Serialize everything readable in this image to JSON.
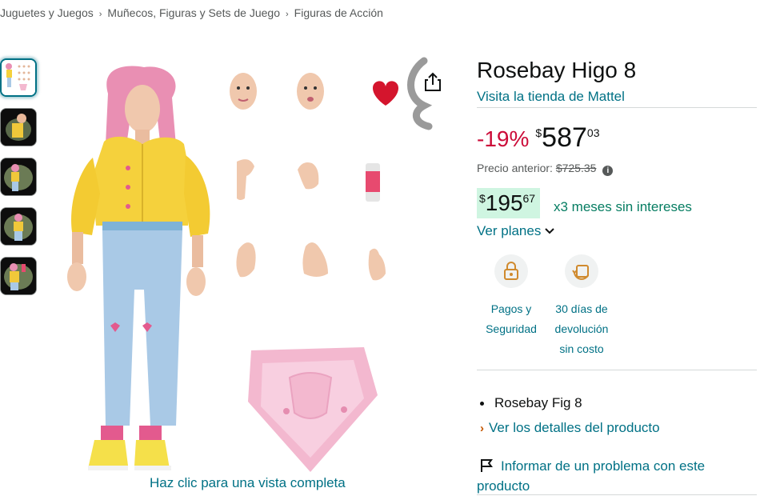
{
  "breadcrumb": [
    "Juguetes y Juegos",
    "Muñecos, Figuras y Sets de Juego",
    "Figuras de Acción"
  ],
  "breadcrumb_sep": "›",
  "gallery": {
    "view_full_label": "Haz clic para una vista completa"
  },
  "product": {
    "title": "Rosebay Higo 8",
    "store_link": "Visita la tienda de Mattel",
    "discount": "-19%",
    "currency": "$",
    "price_whole": "587",
    "price_fraction": "03",
    "previous_price_label": "Precio anterior:",
    "previous_price": "$725.35",
    "info_icon": "i",
    "installment_whole": "195",
    "installment_fraction": "67",
    "installment_text": "x3 meses sin intereses",
    "plans_label": "Ver planes"
  },
  "features": [
    {
      "icon": "secure-payment-icon",
      "line1": "Pagos y",
      "line2": "Seguridad",
      "line3": ""
    },
    {
      "icon": "return-icon",
      "line1": "30 días de",
      "line2": "devolución",
      "line3": "sin costo"
    }
  ],
  "bullets": [
    "Rosebay Fig 8"
  ],
  "details_link": "Ver los detalles del producto",
  "details_chevron": "›",
  "report_text": "Informar de un problema con este producto",
  "colors": {
    "link": "#007185",
    "discount": "#cc0c39",
    "badge_bg": "#cff5e1",
    "badge_text": "#067d62",
    "chevron": "#c45500"
  }
}
